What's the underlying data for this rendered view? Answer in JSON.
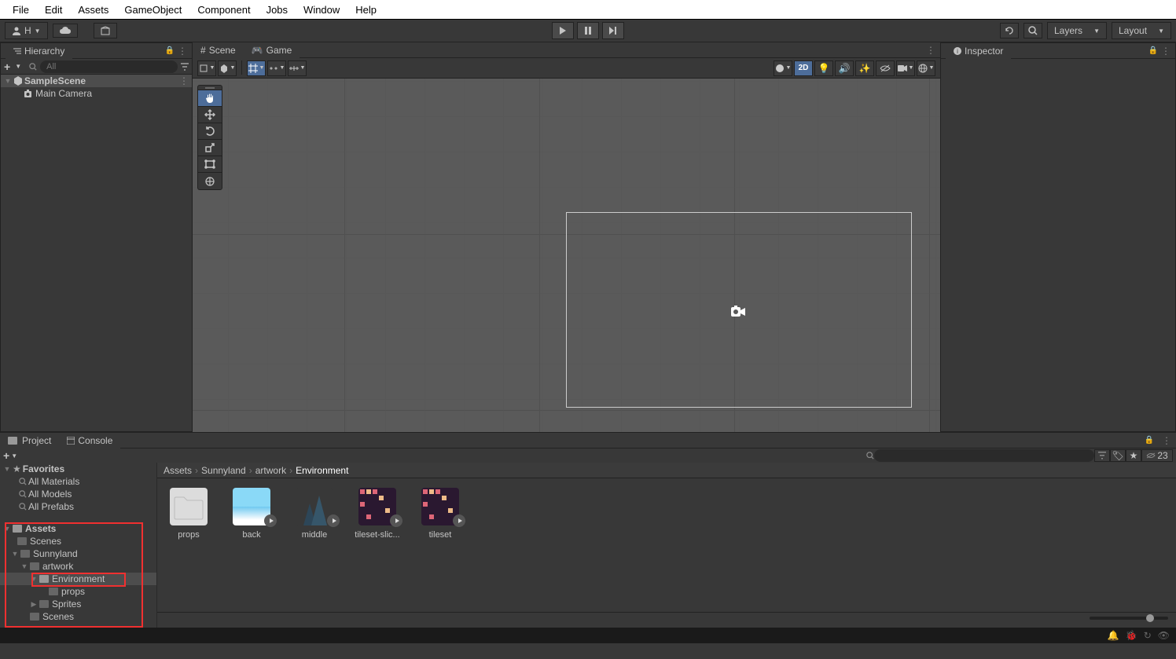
{
  "menubar": [
    "File",
    "Edit",
    "Assets",
    "GameObject",
    "Component",
    "Jobs",
    "Window",
    "Help"
  ],
  "toolbar": {
    "account": "H",
    "layers": "Layers",
    "layout": "Layout"
  },
  "hierarchy": {
    "title": "Hierarchy",
    "search_placeholder": "All",
    "items": {
      "scene": "SampleScene",
      "camera": "Main Camera"
    }
  },
  "scene": {
    "tab_scene": "Scene",
    "tab_game": "Game",
    "mode_2d": "2D"
  },
  "inspector": {
    "title": "Inspector"
  },
  "project": {
    "tab_project": "Project",
    "tab_console": "Console",
    "hidden_count": "23",
    "breadcrumb": [
      "Assets",
      "Sunnyland",
      "artwork",
      "Environment"
    ],
    "favorites": {
      "label": "Favorites",
      "items": [
        "All Materials",
        "All Models",
        "All Prefabs"
      ]
    },
    "tree": {
      "assets": "Assets",
      "scenes1": "Scenes",
      "sunnyland": "Sunnyland",
      "artwork": "artwork",
      "environment": "Environment",
      "props": "props",
      "sprites": "Sprites",
      "scenes2": "Scenes"
    },
    "assets": [
      {
        "name": "props",
        "type": "folder"
      },
      {
        "name": "back",
        "type": "image"
      },
      {
        "name": "middle",
        "type": "image"
      },
      {
        "name": "tileset-slic...",
        "type": "image"
      },
      {
        "name": "tileset",
        "type": "image"
      }
    ]
  }
}
